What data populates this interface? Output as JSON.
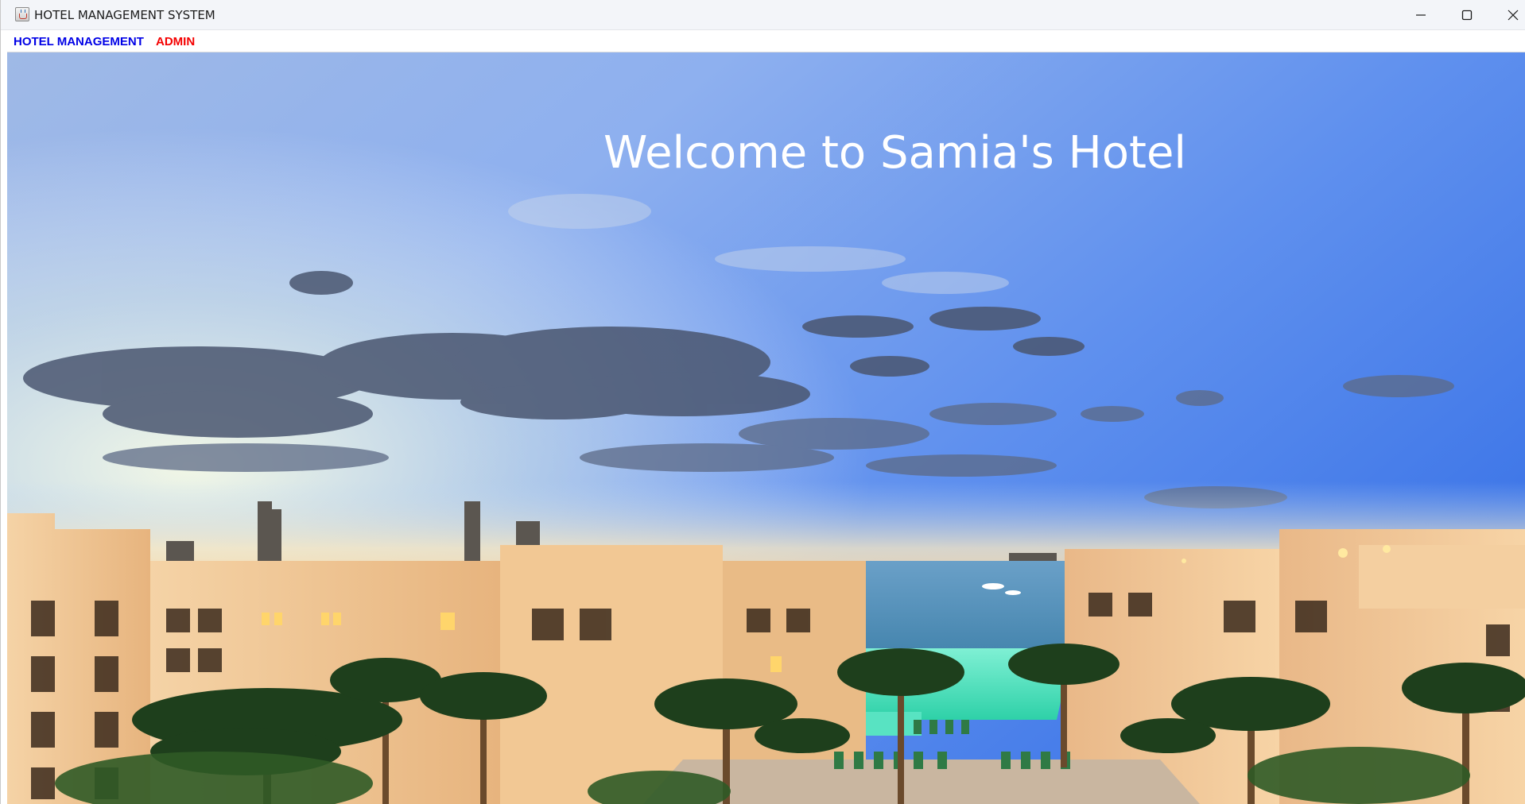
{
  "window": {
    "title": "HOTEL MANAGEMENT SYSTEM",
    "controls": {
      "minimize_icon": "minimize-icon",
      "maximize_icon": "maximize-icon",
      "close_icon": "close-icon"
    }
  },
  "menubar": {
    "items": [
      {
        "label": "HOTEL MANAGEMENT",
        "color": "#0000e6"
      },
      {
        "label": "ADMIN",
        "color": "#f40000"
      }
    ]
  },
  "main": {
    "welcome_text": "Welcome to Samia's Hotel",
    "background_image": "hotel-resort-panorama"
  }
}
